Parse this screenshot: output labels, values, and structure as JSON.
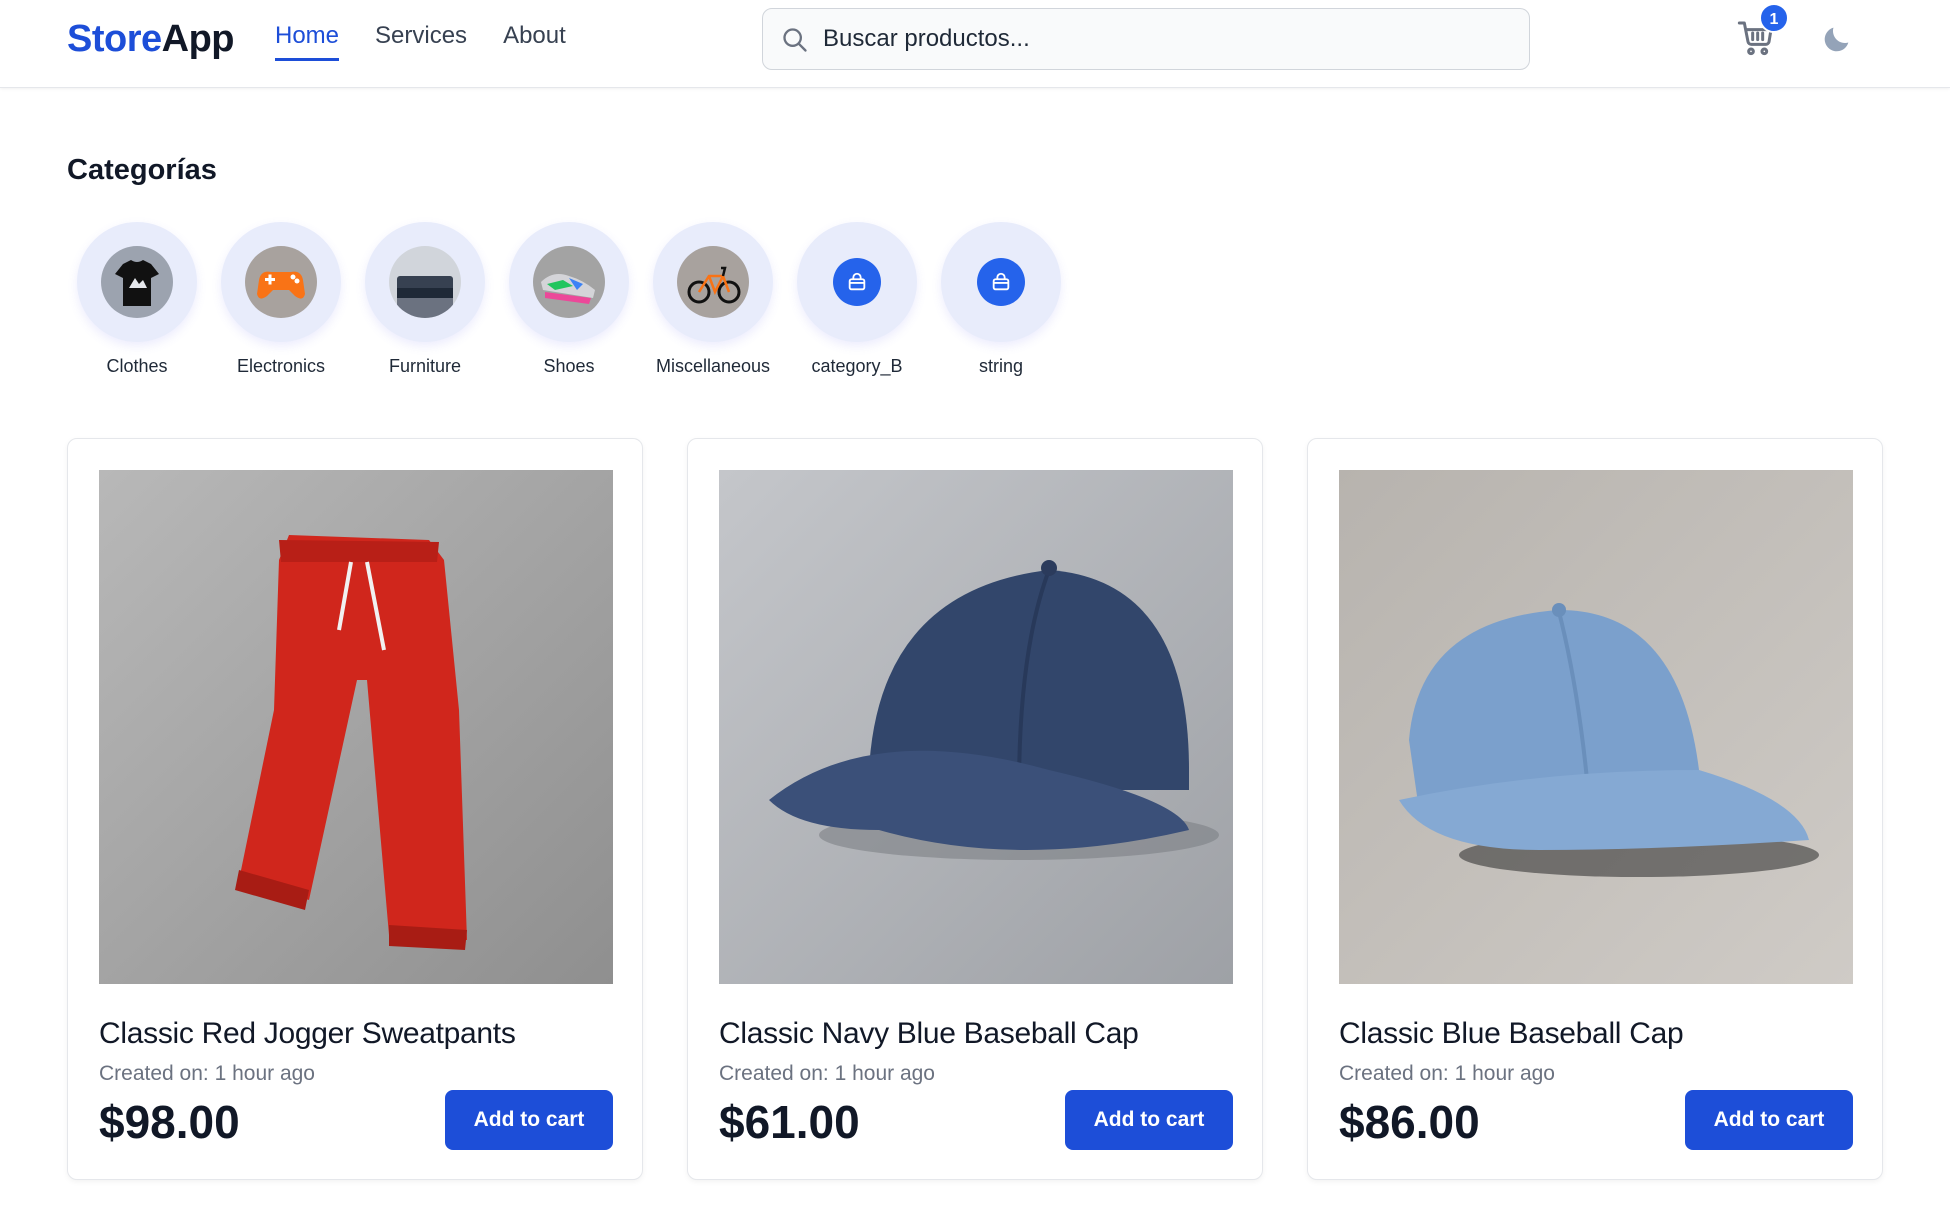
{
  "header": {
    "logo_part1": "Store",
    "logo_part2": "App",
    "nav": [
      {
        "label": "Home",
        "active": true
      },
      {
        "label": "Services",
        "active": false
      },
      {
        "label": "About",
        "active": false
      }
    ],
    "search_placeholder": "Buscar productos...",
    "cart_count": "1",
    "icons": {
      "search": "search-icon",
      "cart": "cart-icon",
      "theme": "moon-icon"
    },
    "accent_color": "#1d4ed8"
  },
  "categories": {
    "title": "Categorías",
    "items": [
      {
        "label": "Clothes",
        "icon": "tshirt-image"
      },
      {
        "label": "Electronics",
        "icon": "gamepad-image"
      },
      {
        "label": "Furniture",
        "icon": "sofa-image"
      },
      {
        "label": "Shoes",
        "icon": "sneakers-image"
      },
      {
        "label": "Miscellaneous",
        "icon": "bicycle-image"
      },
      {
        "label": "category_B",
        "icon": "bag-icon"
      },
      {
        "label": "string",
        "icon": "bag-icon"
      }
    ]
  },
  "products": [
    {
      "name": "Classic Red Jogger Sweatpants",
      "created": "Created on: 1 hour ago",
      "price": "$98.00",
      "button": "Add to cart",
      "image": "red-sweatpants-image"
    },
    {
      "name": "Classic Navy Blue Baseball Cap",
      "created": "Created on: 1 hour ago",
      "price": "$61.00",
      "button": "Add to cart",
      "image": "navy-cap-image"
    },
    {
      "name": "Classic Blue Baseball Cap",
      "created": "Created on: 1 hour ago",
      "price": "$86.00",
      "button": "Add to cart",
      "image": "light-blue-cap-image"
    }
  ]
}
